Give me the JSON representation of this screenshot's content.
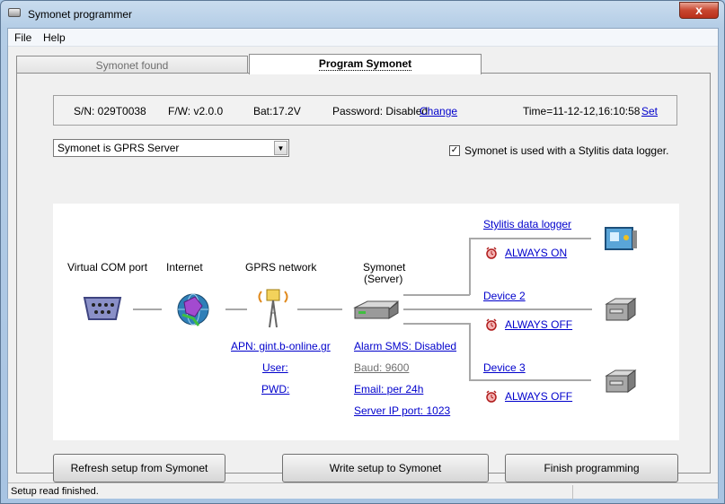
{
  "window": {
    "title": "Symonet programmer",
    "close_label": "x"
  },
  "menu": {
    "file": "File",
    "help": "Help"
  },
  "tabs": [
    {
      "label": "Symonet found"
    },
    {
      "label": "Program Symonet"
    }
  ],
  "info": {
    "sn": "S/N: 029T0038",
    "fw": "F/W: v2.0.0",
    "bat": "Bat:17.2V",
    "password": "Password: Disabled",
    "change_link": "Change",
    "time": "Time=11-12-12,16:10:58",
    "set_link": "Set"
  },
  "mode_select": {
    "value": "Symonet is GPRS Server"
  },
  "logger_check": {
    "checked": true,
    "label": "Symonet is used with a Stylitis data logger."
  },
  "diagram": {
    "virtual_com": "Virtual COM port",
    "internet": "Internet",
    "gprs": "GPRS network",
    "symonet": "Symonet",
    "symonet_role": "(Server)",
    "apn": "APN: gint.b-online.gr",
    "user": "User:",
    "pwd": "PWD:",
    "alarm_sms": "Alarm SMS: Disabled",
    "baud": "Baud: 9600",
    "email": "Email: per 24h",
    "server_ip": "Server IP port: 1023",
    "devices": [
      {
        "name": "Stylitis data logger",
        "status": "ALWAYS ON"
      },
      {
        "name": "Device 2",
        "status": "ALWAYS OFF"
      },
      {
        "name": "Device 3",
        "status": "ALWAYS OFF"
      }
    ]
  },
  "buttons": {
    "refresh": "Refresh setup from Symonet",
    "write": "Write setup to Symonet",
    "finish": "Finish programming"
  },
  "status": {
    "text": "Setup read finished."
  },
  "colors": {
    "link": "#0000cc",
    "panel_bg": "#f0f0f0",
    "diagram_bg": "#ffffff",
    "line": "#a8a8a8"
  }
}
